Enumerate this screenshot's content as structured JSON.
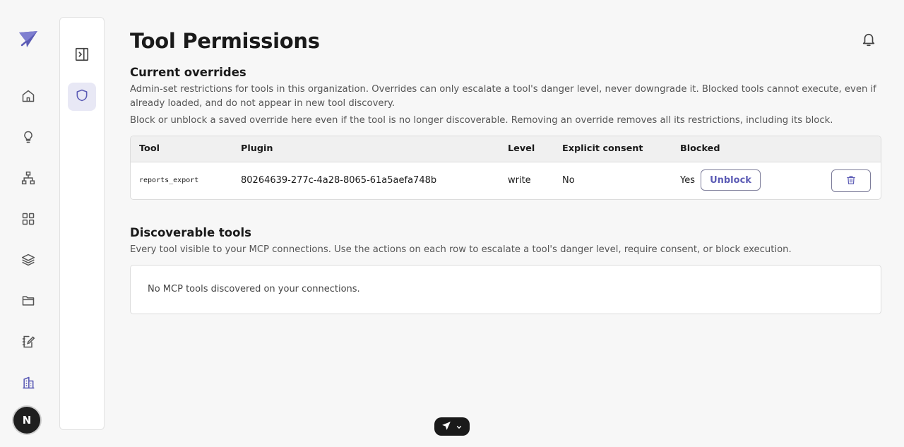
{
  "rail": {
    "nav_items": [
      "home",
      "ideas",
      "workflows",
      "apps",
      "layers",
      "files",
      "notes",
      "organization"
    ],
    "avatar_initial": "N"
  },
  "page": {
    "title": "Tool Permissions"
  },
  "overrides": {
    "title": "Current overrides",
    "desc1": "Admin-set restrictions for tools in this organization. Overrides can only escalate a tool's danger level, never downgrade it. Blocked tools cannot execute, even if already loaded, and do not appear in new tool discovery.",
    "desc2": "Block or unblock a saved override here even if the tool is no longer discoverable. Removing an override removes all its restrictions, including its block.",
    "columns": {
      "tool": "Tool",
      "plugin": "Plugin",
      "level": "Level",
      "consent": "Explicit consent",
      "blocked": "Blocked"
    },
    "rows": [
      {
        "tool": "reports_export",
        "plugin": "80264639-277c-4a28-8065-61a5aefa748b",
        "level": "write",
        "consent": "No",
        "blocked": "Yes",
        "unblock_label": "Unblock"
      }
    ]
  },
  "discoverable": {
    "title": "Discoverable tools",
    "desc": "Every tool visible to your MCP connections. Use the actions on each row to escalate a tool's danger level, require consent, or block execution.",
    "empty_text": "No MCP tools discovered on your connections."
  },
  "colors": {
    "accent": "#5b5bb5",
    "active_bg": "#e8e8f5",
    "rail_icon": "#555555"
  }
}
